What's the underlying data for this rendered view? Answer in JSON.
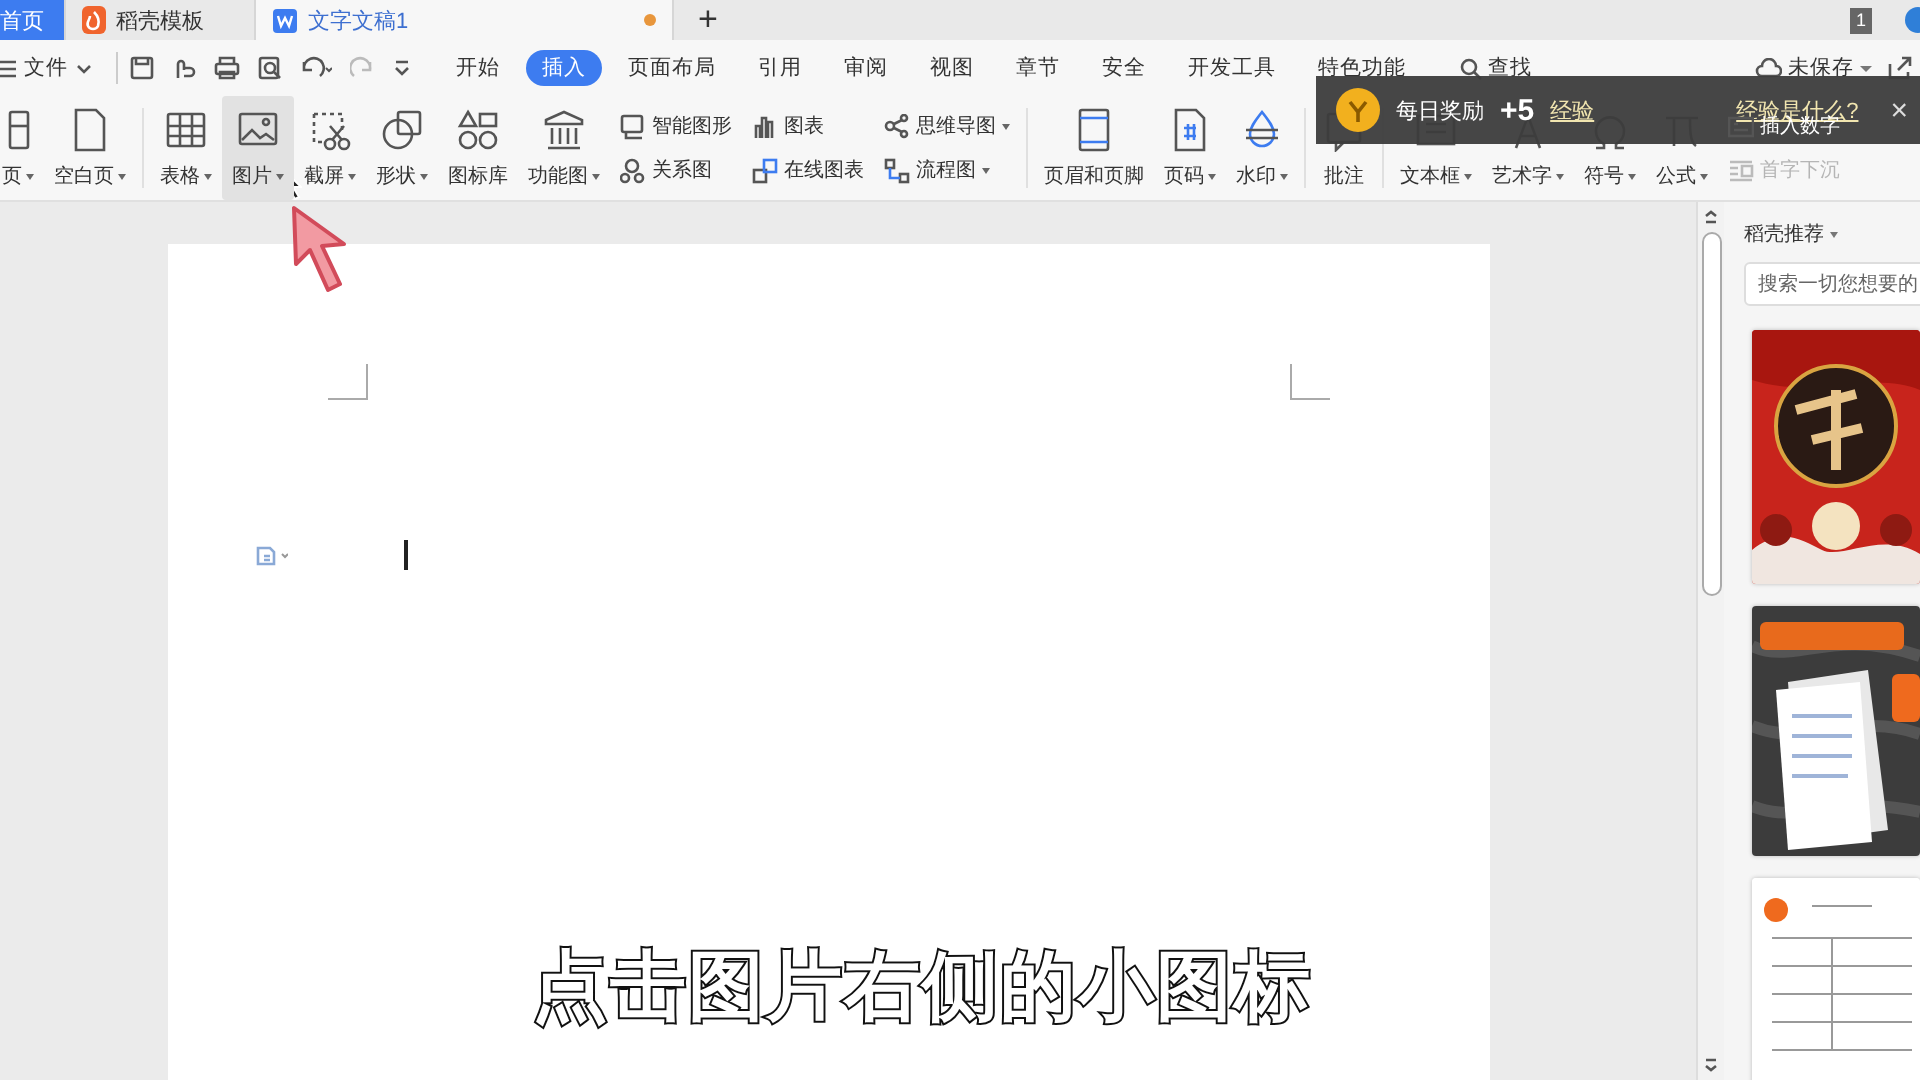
{
  "tabs": [
    {
      "label": "首页",
      "selected": false,
      "kind": "home",
      "modified": false
    },
    {
      "label": "稻壳模板",
      "selected": false,
      "kind": "docer",
      "modified": false
    },
    {
      "label": "文字文稿1",
      "selected": true,
      "kind": "document",
      "modified": true
    }
  ],
  "new_tab": "+",
  "window_count": "1",
  "menu": {
    "file": "文件",
    "tabs": [
      {
        "label": "开始",
        "selected": false
      },
      {
        "label": "插入",
        "selected": true
      },
      {
        "label": "页面布局",
        "selected": false
      },
      {
        "label": "引用",
        "selected": false
      },
      {
        "label": "审阅",
        "selected": false
      },
      {
        "label": "视图",
        "selected": false
      },
      {
        "label": "章节",
        "selected": false
      },
      {
        "label": "安全",
        "selected": false
      },
      {
        "label": "开发工具",
        "selected": false
      },
      {
        "label": "特色功能",
        "selected": false
      }
    ],
    "search": "查找",
    "save_status": "未保存"
  },
  "ribbon": [
    {
      "kind": "large",
      "label": "页",
      "dropdown": true,
      "hovered": false
    },
    {
      "kind": "large",
      "label": "空白页",
      "dropdown": true,
      "hovered": false
    },
    {
      "kind": "large",
      "label": "表格",
      "dropdown": true,
      "hovered": false
    },
    {
      "kind": "large",
      "label": "图片",
      "dropdown": true,
      "hovered": true
    },
    {
      "kind": "large",
      "label": "截屏",
      "dropdown": true,
      "hovered": false
    },
    {
      "kind": "large",
      "label": "形状",
      "dropdown": true,
      "hovered": false
    },
    {
      "kind": "large",
      "label": "图标库",
      "dropdown": false,
      "hovered": false
    },
    {
      "kind": "large",
      "label": "功能图",
      "dropdown": true,
      "hovered": false
    },
    {
      "kind": "stack",
      "items": [
        {
          "label": "智能图形",
          "dropdown": false,
          "disabled": false
        },
        {
          "label": "关系图",
          "dropdown": false,
          "disabled": false
        }
      ]
    },
    {
      "kind": "stack",
      "items": [
        {
          "label": "图表",
          "dropdown": false,
          "disabled": false
        },
        {
          "label": "在线图表",
          "dropdown": false,
          "disabled": false
        }
      ]
    },
    {
      "kind": "stack",
      "items": [
        {
          "label": "思维导图",
          "dropdown": true,
          "disabled": false
        },
        {
          "label": "流程图",
          "dropdown": true,
          "disabled": false
        }
      ]
    },
    {
      "kind": "large",
      "label": "页眉和页脚",
      "dropdown": false,
      "hovered": false
    },
    {
      "kind": "large",
      "label": "页码",
      "dropdown": true,
      "hovered": false
    },
    {
      "kind": "large",
      "label": "水印",
      "dropdown": true,
      "hovered": false
    },
    {
      "kind": "large",
      "label": "批注",
      "dropdown": false,
      "hovered": false
    },
    {
      "kind": "large",
      "label": "文本框",
      "dropdown": true,
      "hovered": false
    },
    {
      "kind": "large",
      "label": "艺术字",
      "dropdown": true,
      "hovered": false
    },
    {
      "kind": "large",
      "label": "符号",
      "dropdown": true,
      "hovered": false
    },
    {
      "kind": "large",
      "label": "公式",
      "dropdown": true,
      "hovered": false
    },
    {
      "kind": "stack",
      "items": [
        {
          "label": "插入数字",
          "dropdown": false,
          "disabled": false
        },
        {
          "label": "首字下沉",
          "dropdown": false,
          "disabled": true
        }
      ]
    }
  ],
  "toast": {
    "title": "每日奖励",
    "points": "+5",
    "unit": "经验",
    "link": "经验是什么?",
    "close": "×"
  },
  "side_panel": {
    "title": "稻壳推荐",
    "search": {
      "placeholder": "搜索一切您想要的"
    }
  },
  "caption": "点击图片右侧的小图标"
}
